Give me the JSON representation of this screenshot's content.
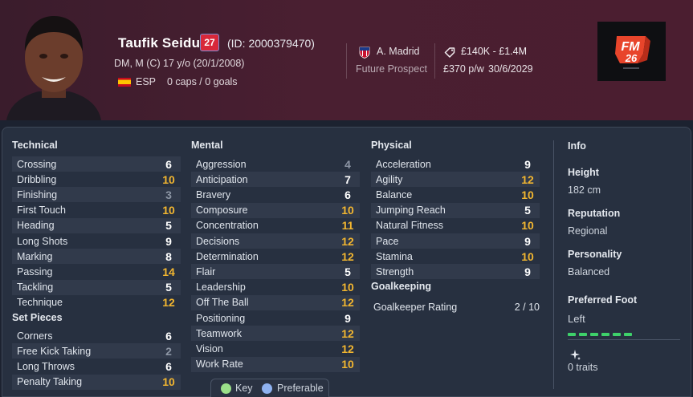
{
  "player": {
    "name": "Taufik Seidu",
    "number": "27",
    "id": "(ID: 2000379470)",
    "positions": "DM, M (C)",
    "age": "17 y/o (20/1/2008)",
    "nationality": "ESP",
    "caps": "0 caps / 0 goals",
    "club": "A. Madrid",
    "status": "Future Prospect",
    "value": "£140K - £1.4M",
    "wage": "£370 p/w",
    "contract_end": "30/6/2029"
  },
  "logo": {
    "text_fm": "FM",
    "text_year": "26"
  },
  "colors": {
    "attr_high": "#f2b630",
    "attr_mid": "#ffffff",
    "attr_low": "#8c95a4",
    "brand_red": "#d8283a"
  },
  "technical": {
    "title": "Technical",
    "items": [
      {
        "label": "Crossing",
        "value": "6",
        "tier": "w"
      },
      {
        "label": "Dribbling",
        "value": "10",
        "tier": "y"
      },
      {
        "label": "Finishing",
        "value": "3",
        "tier": "g"
      },
      {
        "label": "First Touch",
        "value": "10",
        "tier": "y"
      },
      {
        "label": "Heading",
        "value": "5",
        "tier": "w"
      },
      {
        "label": "Long Shots",
        "value": "9",
        "tier": "w"
      },
      {
        "label": "Marking",
        "value": "8",
        "tier": "w"
      },
      {
        "label": "Passing",
        "value": "14",
        "tier": "y"
      },
      {
        "label": "Tackling",
        "value": "5",
        "tier": "w"
      },
      {
        "label": "Technique",
        "value": "12",
        "tier": "y"
      }
    ]
  },
  "set_pieces": {
    "title": "Set Pieces",
    "items": [
      {
        "label": "Corners",
        "value": "6",
        "tier": "w"
      },
      {
        "label": "Free Kick Taking",
        "value": "2",
        "tier": "g"
      },
      {
        "label": "Long Throws",
        "value": "6",
        "tier": "w"
      },
      {
        "label": "Penalty Taking",
        "value": "10",
        "tier": "y"
      }
    ]
  },
  "mental": {
    "title": "Mental",
    "items": [
      {
        "label": "Aggression",
        "value": "4",
        "tier": "g"
      },
      {
        "label": "Anticipation",
        "value": "7",
        "tier": "w"
      },
      {
        "label": "Bravery",
        "value": "6",
        "tier": "w"
      },
      {
        "label": "Composure",
        "value": "10",
        "tier": "y"
      },
      {
        "label": "Concentration",
        "value": "11",
        "tier": "y"
      },
      {
        "label": "Decisions",
        "value": "12",
        "tier": "y"
      },
      {
        "label": "Determination",
        "value": "12",
        "tier": "y"
      },
      {
        "label": "Flair",
        "value": "5",
        "tier": "w"
      },
      {
        "label": "Leadership",
        "value": "10",
        "tier": "y"
      },
      {
        "label": "Off The Ball",
        "value": "12",
        "tier": "y"
      },
      {
        "label": "Positioning",
        "value": "9",
        "tier": "w"
      },
      {
        "label": "Teamwork",
        "value": "12",
        "tier": "y"
      },
      {
        "label": "Vision",
        "value": "12",
        "tier": "y"
      },
      {
        "label": "Work Rate",
        "value": "10",
        "tier": "y"
      }
    ]
  },
  "physical": {
    "title": "Physical",
    "items": [
      {
        "label": "Acceleration",
        "value": "9",
        "tier": "w"
      },
      {
        "label": "Agility",
        "value": "12",
        "tier": "y"
      },
      {
        "label": "Balance",
        "value": "10",
        "tier": "y"
      },
      {
        "label": "Jumping Reach",
        "value": "5",
        "tier": "w"
      },
      {
        "label": "Natural Fitness",
        "value": "10",
        "tier": "y"
      },
      {
        "label": "Pace",
        "value": "9",
        "tier": "w"
      },
      {
        "label": "Stamina",
        "value": "10",
        "tier": "y"
      },
      {
        "label": "Strength",
        "value": "9",
        "tier": "w"
      }
    ]
  },
  "goalkeeping": {
    "title": "Goalkeeping",
    "rating_label": "Goalkeeper Rating",
    "rating_value": "2 / 10"
  },
  "info": {
    "title": "Info",
    "height_label": "Height",
    "height": "182 cm",
    "reputation_label": "Reputation",
    "reputation": "Regional",
    "personality_label": "Personality",
    "personality": "Balanced",
    "foot_label": "Preferred Foot",
    "foot": "Left",
    "traits": "0 traits"
  },
  "legend": {
    "key_label": "Key",
    "preferable_label": "Preferable"
  }
}
